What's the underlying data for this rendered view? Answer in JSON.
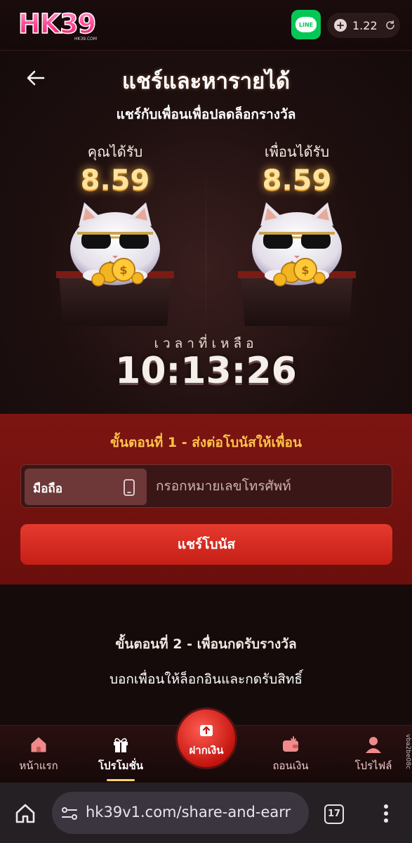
{
  "header": {
    "logo_text": "HK39",
    "logo_sub": "HK39.COM",
    "line_label": "LINE",
    "balance": "1.22"
  },
  "page": {
    "title": "แชร์และหารายได้",
    "subtitle": "แชร์กับเพื่อนเพื่อปลดล็อกรางวัล"
  },
  "rewards": {
    "you_label": "คุณได้รับ",
    "you_amount": "8.59",
    "friend_label": "เพื่อนได้รับ",
    "friend_amount": "8.59"
  },
  "countdown": {
    "label": "เวลาที่เหลือ",
    "value": "10:13:26"
  },
  "step1": {
    "title": "ขั้นตอนที่ 1 - ส่งต่อโบนัสให้เพื่อน",
    "type_label": "มือถือ",
    "phone_placeholder": "กรอกหมายเลขโทรศัพท์",
    "phone_value": "",
    "share_button": "แชร์โบนัส"
  },
  "step2": {
    "title": "ขั้นตอนที่ 2 - เพื่อนกดรับรางวัล",
    "description": "บอกเพื่อนให้ล็อกอินและกดรับสิทธิ์"
  },
  "tabbar": {
    "items": [
      {
        "label": "หน้าแรก",
        "icon": "home-icon"
      },
      {
        "label": "โปรโมชั่น",
        "icon": "gift-icon",
        "active": true
      },
      {
        "label": "ฝากเงิน",
        "icon": "deposit-icon"
      },
      {
        "label": "ถอนเงิน",
        "icon": "wallet-icon"
      },
      {
        "label": "โปรไฟล์",
        "icon": "profile-icon"
      }
    ],
    "build_tag": "vba2be08c"
  },
  "browser": {
    "url": "hk39v1.com/share-and-earr",
    "tab_count": "17"
  },
  "colors": {
    "accent_red": "#c51f16",
    "step_title_gold": "#ffc24a",
    "amount_gold": "#ffe39a",
    "line_green": "#06c755"
  }
}
